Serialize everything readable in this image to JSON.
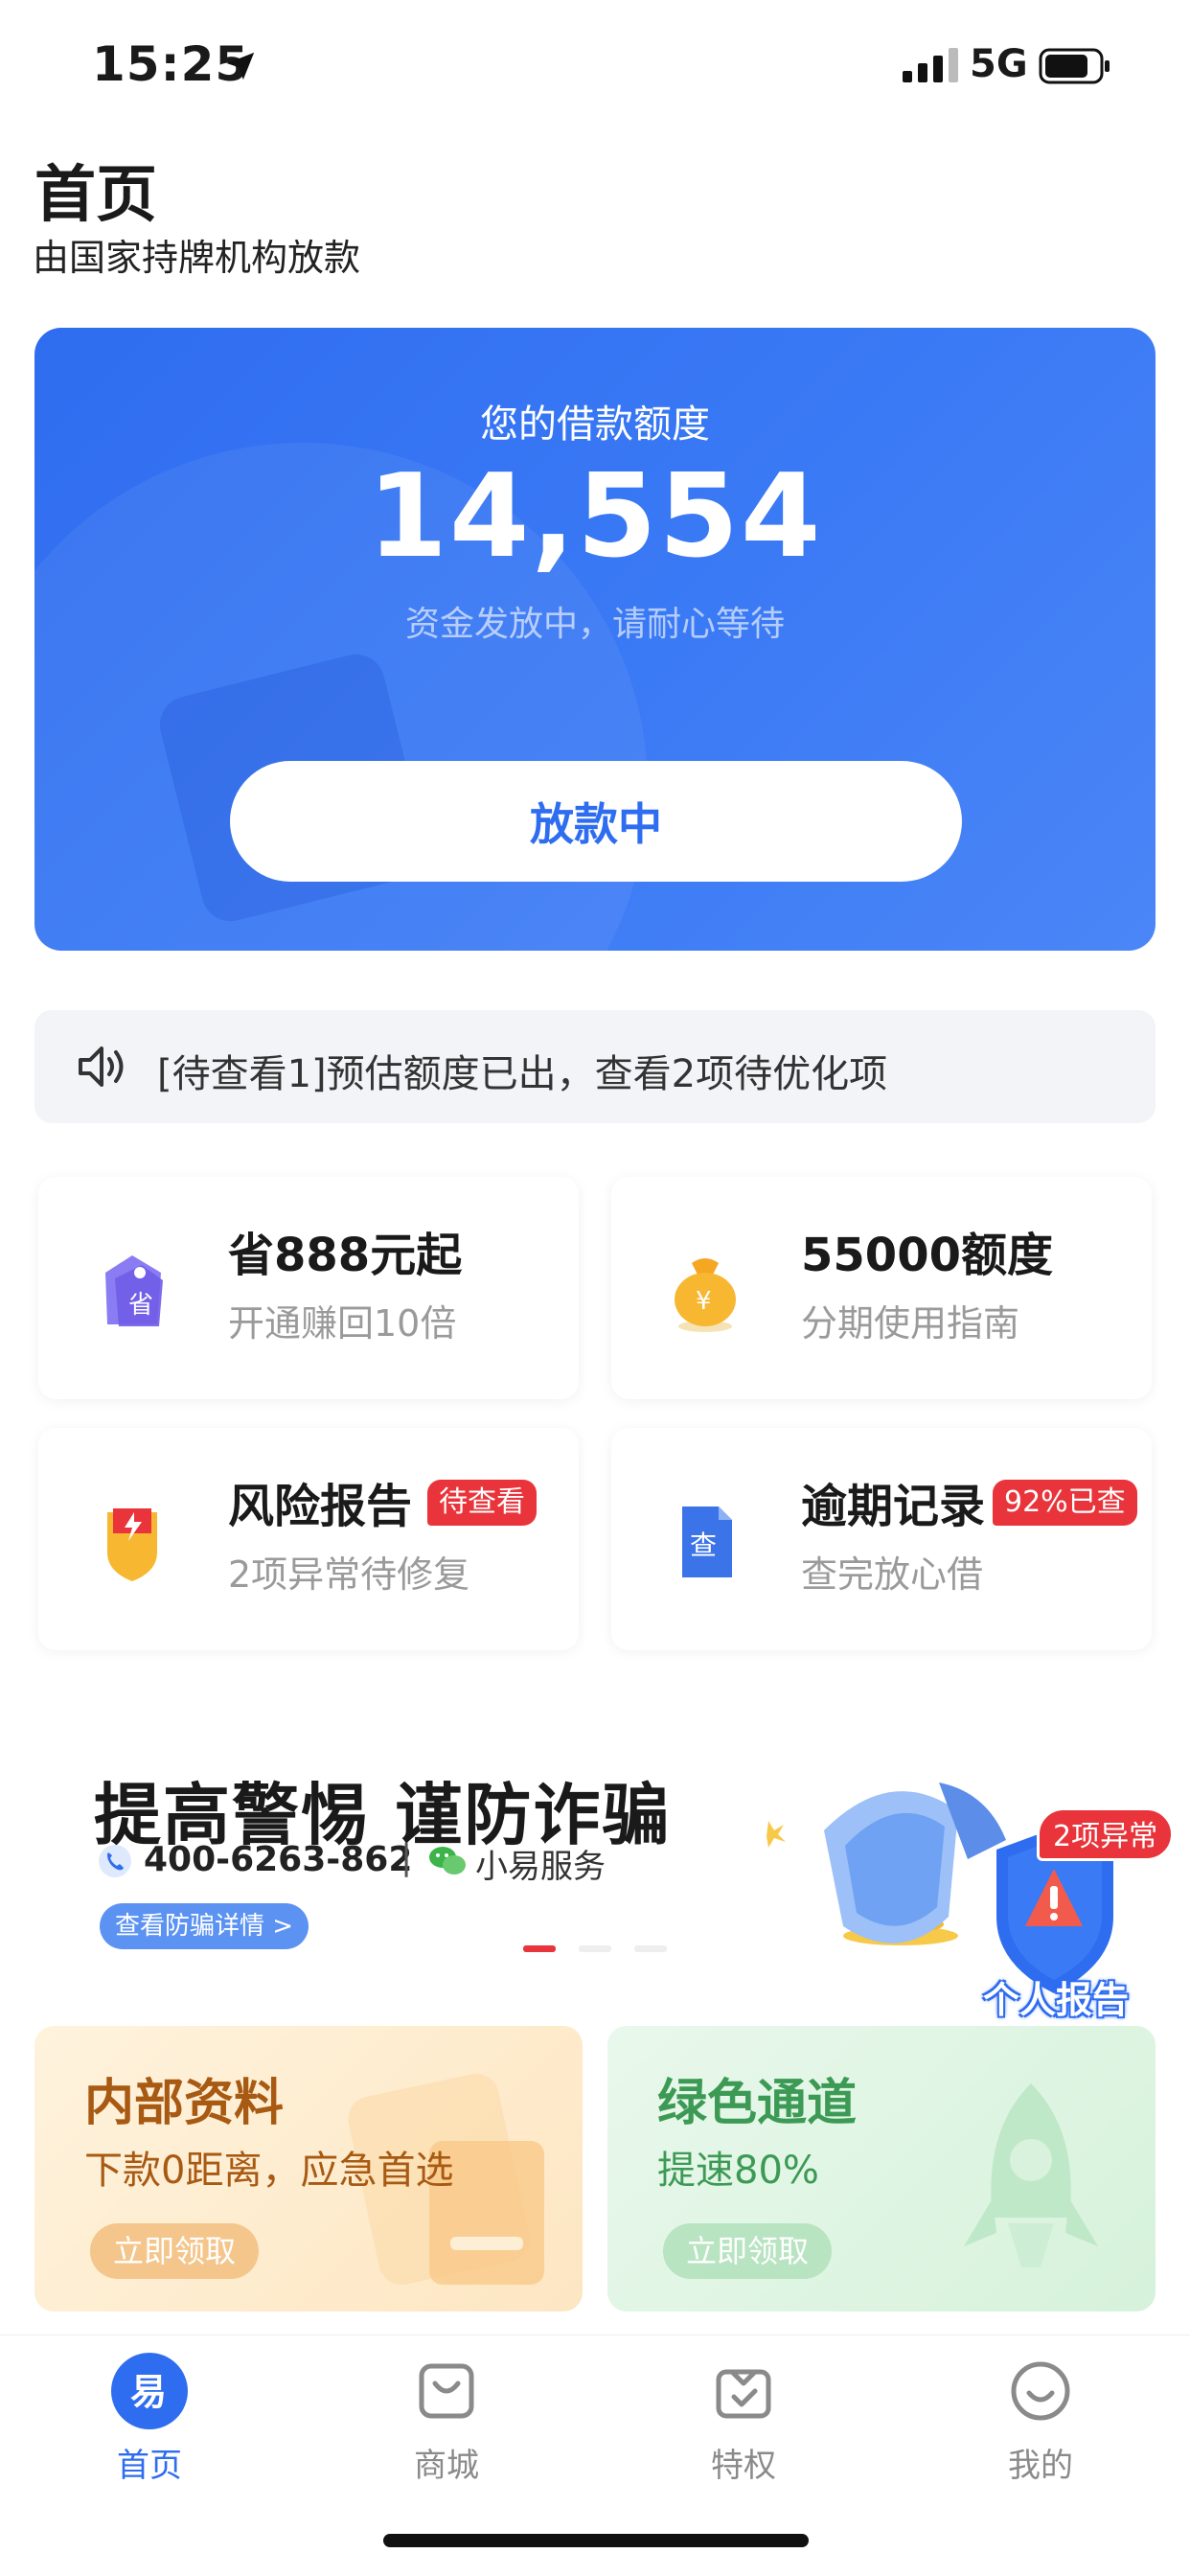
{
  "status_bar": {
    "time": "15:25",
    "network": "5G"
  },
  "header": {
    "title": "首页",
    "subtitle": "由国家持牌机构放款"
  },
  "credit_card": {
    "label": "您的借款额度",
    "amount": "14,554",
    "status": "资金发放中，请耐心等待",
    "button_label": "放款中"
  },
  "notice": {
    "text": "[待查看1]预估额度已出，查看2项待优化项"
  },
  "features": [
    {
      "title": "省888元起",
      "subtitle": "开通赚回10倍",
      "icon": "discount-tag-icon"
    },
    {
      "title": "55000额度",
      "subtitle": "分期使用指南",
      "icon": "money-bag-icon"
    },
    {
      "title": "风险报告",
      "subtitle": "2项异常待修复",
      "badge": "待查看",
      "icon": "risk-shield-icon"
    },
    {
      "title": "逾期记录",
      "subtitle": "查完放心借",
      "badge": "92%已查",
      "icon": "document-check-icon"
    }
  ],
  "fraud_banner": {
    "title": "提高警惕 谨防诈骗",
    "phone": "400-6263-862",
    "separator": "|",
    "wechat": "小易服务",
    "detail_button": "查看防骗详情 >",
    "report_badge": "2项异常",
    "report_label": "个人报告"
  },
  "promos": [
    {
      "title": "内部资料",
      "subtitle": "下款0距离，应急首选",
      "button": "立即领取"
    },
    {
      "title": "绿色通道",
      "subtitle": "提速80%",
      "button": "立即领取"
    }
  ],
  "tabs": [
    {
      "label": "首页",
      "active": true,
      "icon": "home-logo-icon"
    },
    {
      "label": "商城",
      "active": false,
      "icon": "shopping-bag-icon"
    },
    {
      "label": "特权",
      "active": false,
      "icon": "privilege-box-icon"
    },
    {
      "label": "我的",
      "active": false,
      "icon": "smiley-profile-icon"
    }
  ],
  "colors": {
    "primary": "#2f6df0",
    "badge_red": "#e8343a",
    "carousel_active": "#e8343a"
  }
}
